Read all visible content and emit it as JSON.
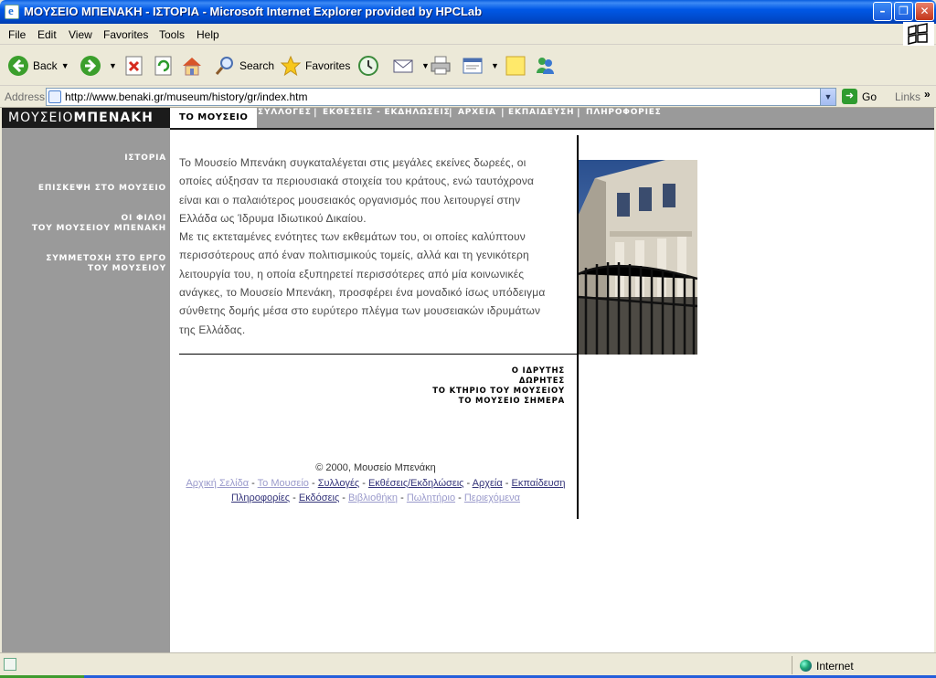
{
  "window": {
    "title": "ΜΟΥΣΕΙΟ ΜΠΕΝΑΚΗ - ΙΣΤΟΡΙΑ - Microsoft Internet Explorer provided by HPCLab",
    "minimize_glyph": "–",
    "maximize_glyph": "❐",
    "close_glyph": "✕"
  },
  "menubar": {
    "items": [
      "File",
      "Edit",
      "View",
      "Favorites",
      "Tools",
      "Help"
    ]
  },
  "toolbar": {
    "back_label": "Back",
    "search_label": "Search",
    "favorites_label": "Favorites"
  },
  "addressbar": {
    "label": "Address",
    "url": "http://www.benaki.gr/museum/history/gr/index.htm",
    "go_label": "Go",
    "links_label": "Links"
  },
  "site": {
    "logo_light": "ΜΟΥΣΕΙΟ",
    "logo_bold": "ΜΠΕΝΑΚΗ",
    "topnav_active": "ΤΟ ΜΟΥΣΕΙΟ",
    "topnav": [
      "ΣΥΛΛΟΓΕΣ",
      "ΕΚΘΕΣΕΙΣ - ΕΚΔΗΛΩΣΕΙΣ",
      "ΑΡΧΕΙΑ",
      "ΕΚΠΑΙΔΕΥΣΗ",
      "ΠΛΗΡΟΦΟΡΙΕΣ"
    ],
    "topnav_sep": "|",
    "sidebar": {
      "active": "ΙΣΤΟΡΙΑ",
      "visit": "ΕΠΙΣΚΕΨΗ ΣΤΟ ΜΟΥΣΕΙΟ",
      "friends_line1": "ΟΙ ΦΙΛΟΙ",
      "friends_line2": "ΤΟΥ ΜΟΥΣΕΙΟΥ ΜΠΕΝΑΚΗ",
      "participate_line1": "ΣΥΜΜΕΤΟΧΗ ΣΤΟ ΕΡΓΟ",
      "participate_line2": "ΤΟΥ ΜΟΥΣΕΙΟΥ"
    },
    "body_lines": [
      "Το Μουσείο Μπενάκη συγκαταλέγεται στις μεγάλες εκείνες δωρεές, οι",
      "οποίες αύξησαν τα περιουσιακά στοιχεία του κράτους, ενώ ταυτόχρονα",
      "είναι και ο παλαιότερος μουσειακός οργανισμός που λειτουργεί στην",
      "Ελλάδα ως Ίδρυμα Ιδιωτικού Δικαίου.",
      "Με τις εκτεταμένες ενότητες των εκθεμάτων του, οι οποίες καλύπτουν",
      "περισσότερους από έναν πολιτισμικούς τομείς, αλλά και τη γενικότερη",
      "λειτουργία του, η οποία εξυπηρετεί περισσότερες από μία κοινωνικές",
      "ανάγκες, το Μουσείο Μπενάκη, προσφέρει ένα μοναδικό ίσως υπόδειγμα",
      "σύνθετης δομής μέσα στο ευρύτερο πλέγμα των μουσειακών ιδρυμάτων",
      "της Ελλάδας."
    ],
    "subnav": [
      "Ο ΙΔΡΥΤΗΣ",
      "ΔΩΡΗΤΕΣ",
      "ΤΟ ΚΤΗΡΙΟ ΤΟΥ ΜΟΥΣΕΙΟΥ",
      "ΤΟ ΜΟΥΣΕΙΟ ΣΗΜΕΡΑ"
    ],
    "footer": {
      "copyright": "© 2000, Μουσείο Μπενάκη",
      "separator": " - ",
      "row1": [
        "Αρχική Σελίδα",
        "Το Μουσείο",
        "Συλλογές",
        "Εκθέσεις/Εκδηλώσεις",
        "Αρχεία",
        "Εκπαίδευση"
      ],
      "row2": [
        "Πληροφορίες",
        "Εκδόσεις",
        "Βιβλιοθήκη",
        "Πωλητήριο",
        "Περιεχόμενα"
      ]
    }
  },
  "statusbar": {
    "zone": "Internet"
  },
  "colors": {
    "titlebar_blue": "#0058e6",
    "site_gray": "#9a9a9a",
    "site_black": "#1b1b1b",
    "link_visited": "#9a9acb",
    "link_normal": "#34347a"
  }
}
